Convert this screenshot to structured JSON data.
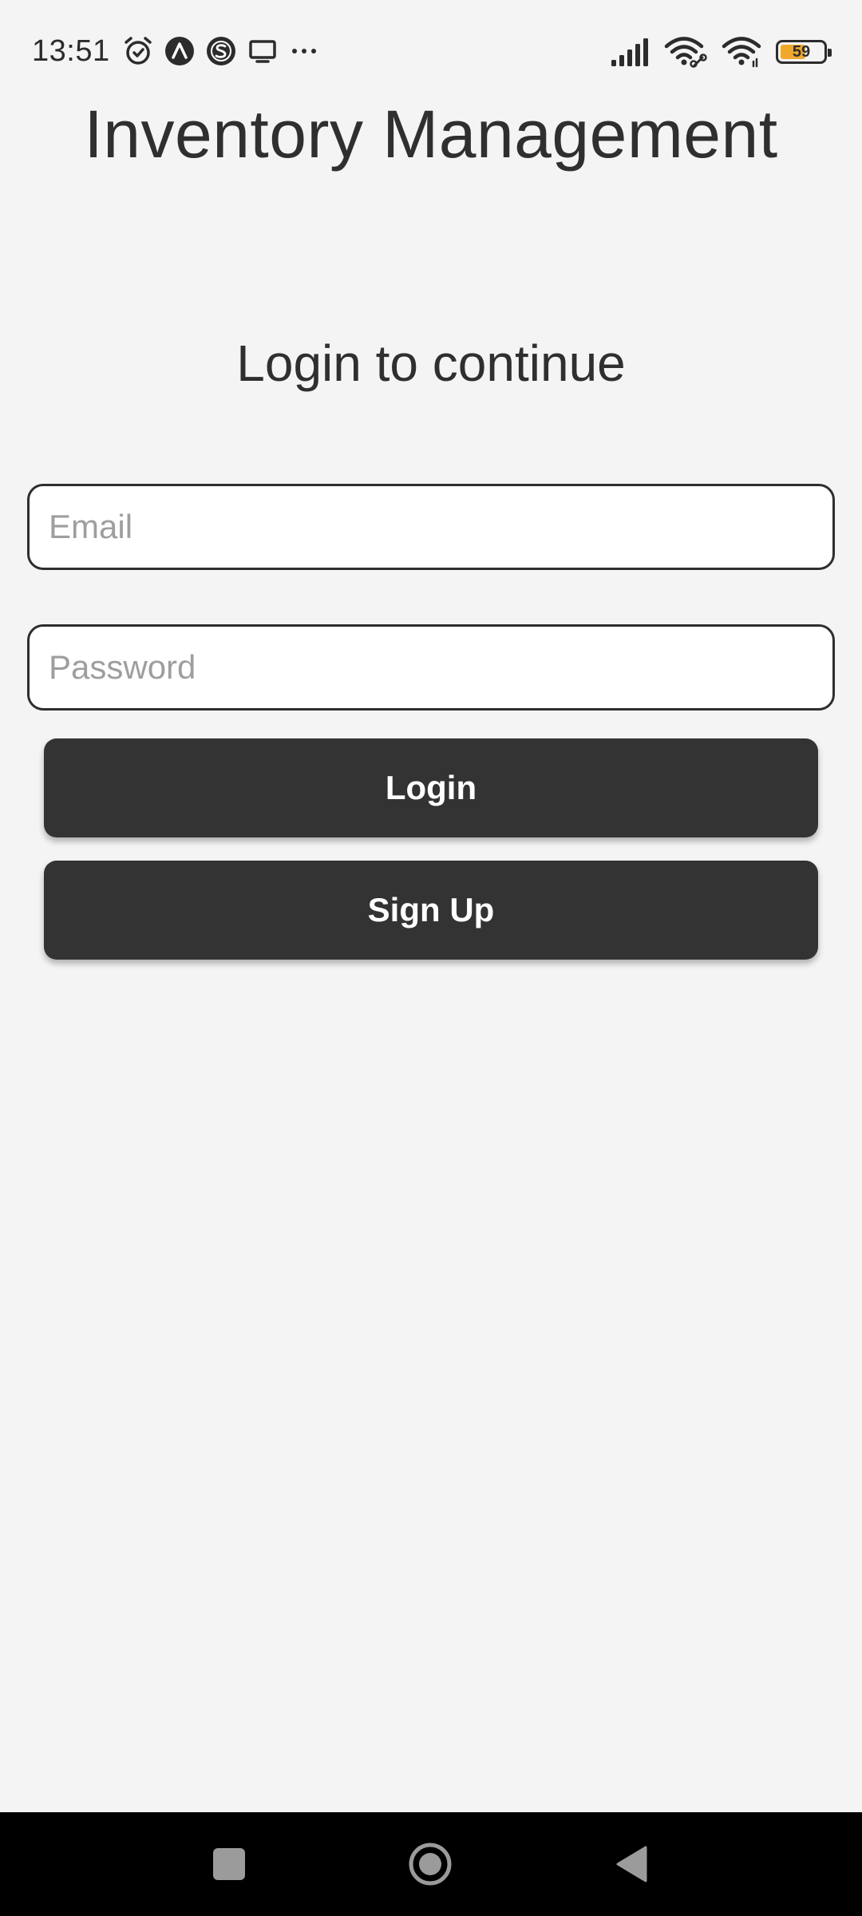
{
  "status_bar": {
    "time": "13:51",
    "left_icons": [
      "alarm-icon",
      "app-a-icon",
      "app-s-icon",
      "cast-screen-icon",
      "more-dots-icon"
    ],
    "right_icons": [
      "cellular-signal-icon",
      "wifi-link-icon",
      "wifi-icon",
      "battery-icon"
    ],
    "battery_level": "59",
    "battery_fraction": 0.59,
    "battery_color": "#f0a82b"
  },
  "app": {
    "title": "Inventory Management",
    "subtitle": "Login to continue"
  },
  "form": {
    "email_placeholder": "Email",
    "email_value": "",
    "password_placeholder": "Password",
    "password_value": ""
  },
  "buttons": {
    "login_label": "Login",
    "signup_label": "Sign Up"
  },
  "nav_bar": {
    "items": [
      "recent-apps-icon",
      "home-icon",
      "back-icon"
    ]
  },
  "colors": {
    "background": "#f4f4f4",
    "button": "#333333",
    "button_text": "#ffffff",
    "text": "#2f2f2f",
    "placeholder": "#9e9e9e",
    "nav_background": "#000000"
  }
}
